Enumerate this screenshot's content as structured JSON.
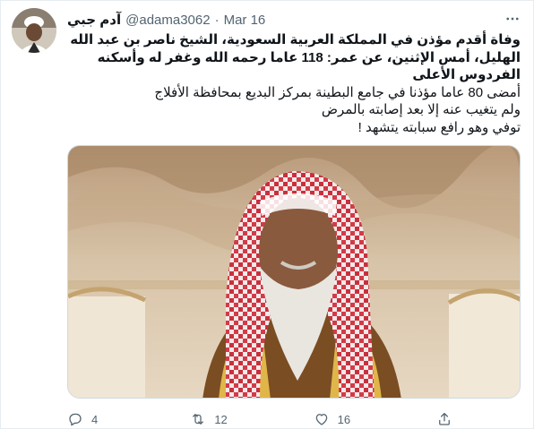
{
  "tweet": {
    "display_name": "آدم جبي",
    "handle": "@adama3062",
    "separator": "·",
    "date": "Mar 16",
    "more_icon": "more-horizontal-icon",
    "text_lines": {
      "line1": "وفاة أقدم مؤذن في المملكة العربية السعودية، الشيخ ناصر بن عبد الله الهليل، أمس الإثنين، عن عمر: 118 عاما رحمه الله وغفر له وأسكنه الفردوس الأعلى",
      "line2": "أمضى 80 عاما مؤذنا في جامع البطينة بمركز البديع بمحافظة الأفلاج",
      "line3": "ولم يتغيب عنه إلا بعد إصابته بالمرض",
      "line4": "توفي وهو رافع سبابته يتشهد !"
    },
    "photo_icon": "photo-elderly-man-red-white-shemagh"
  },
  "actions": {
    "reply": {
      "icon": "reply-icon",
      "count": "4"
    },
    "retweet": {
      "icon": "retweet-icon",
      "count": "12"
    },
    "like": {
      "icon": "heart-icon",
      "count": "16"
    },
    "share": {
      "icon": "share-icon"
    }
  },
  "colors": {
    "text": "#0f1419",
    "secondary": "#536471",
    "border": "#e6ecf0"
  }
}
